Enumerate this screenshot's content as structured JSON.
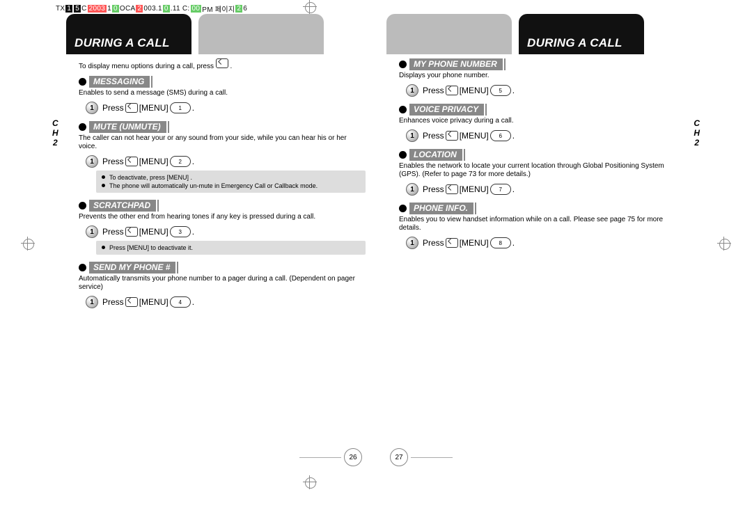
{
  "doc_header": {
    "parts": [
      "TX",
      "1",
      "5",
      "C",
      "2003",
      "1",
      "0",
      "OCA  ",
      "2",
      "0",
      "03.1",
      "0",
      ".11 C:",
      "00",
      " PM  페이지 ",
      "2",
      "6"
    ]
  },
  "spread_title": "DURING A CALL",
  "chapter_label": {
    "line1": "C",
    "line2": "H",
    "line3": "2"
  },
  "page_left": {
    "intro_pre": "To display menu options during a call, press ",
    "intro_post": " .",
    "sections": [
      {
        "title": "MESSAGING",
        "desc": "Enables to send a message (SMS) during a call.",
        "step_label": "1",
        "press": "Press",
        "menu": "[MENU]",
        "numkey": "1"
      },
      {
        "title": "MUTE (UNMUTE)",
        "desc": "The caller can not hear your or any sound from your side, while you can hear his or her voice.",
        "step_label": "1",
        "press": "Press",
        "menu": "[MENU]",
        "numkey": "2",
        "notes": [
          "To deactivate, press       [MENU]        .",
          "The phone will automatically un-mute in Emergency Call or Callback mode."
        ]
      },
      {
        "title": "SCRATCHPAD",
        "desc": "Prevents the other end from hearing tones if any key is pressed during a call.",
        "step_label": "1",
        "press": "Press",
        "menu": "[MENU]",
        "numkey": "3",
        "notes": [
          "Press       [MENU]        to deactivate it."
        ]
      },
      {
        "title": "SEND MY PHONE #",
        "desc": "Automatically transmits your phone number to a pager during a call. (Dependent on pager service)",
        "step_label": "1",
        "press": "Press",
        "menu": "[MENU]",
        "numkey": "4"
      }
    ],
    "page_number": "26"
  },
  "page_right": {
    "sections": [
      {
        "title": "MY PHONE NUMBER",
        "desc": "Displays your phone number.",
        "step_label": "1",
        "press": "Press",
        "menu": "[MENU]",
        "numkey": "5"
      },
      {
        "title": "VOICE PRIVACY",
        "desc": "Enhances voice privacy during a call.",
        "step_label": "1",
        "press": "Press",
        "menu": "[MENU]",
        "numkey": "6"
      },
      {
        "title": "LOCATION",
        "desc": "Enables the network to locate your current location through Global Positioning System (GPS). (Refer to page 73 for more details.)",
        "step_label": "1",
        "press": "Press",
        "menu": "[MENU]",
        "numkey": "7"
      },
      {
        "title": "PHONE INFO.",
        "desc": "Enables you to view handset information while on a call. Please see page 75 for more details.",
        "step_label": "1",
        "press": "Press",
        "menu": "[MENU]",
        "numkey": "8"
      }
    ],
    "page_number": "27"
  }
}
